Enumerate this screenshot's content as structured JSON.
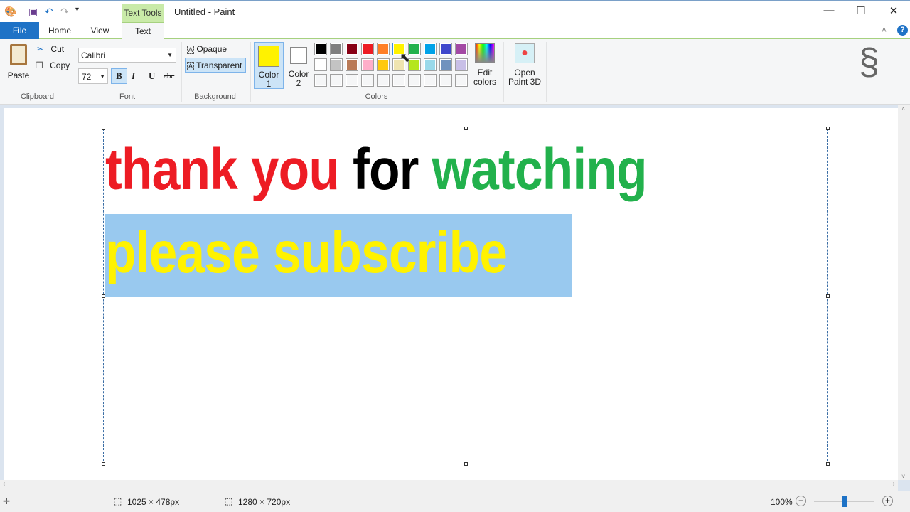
{
  "window": {
    "title": "Untitled - Paint",
    "context_tab": "Text Tools",
    "minimize": "—",
    "maximize": "☐",
    "close": "✕"
  },
  "tabs": [
    {
      "label": "File"
    },
    {
      "label": "Home"
    },
    {
      "label": "View"
    },
    {
      "label": "Text"
    }
  ],
  "clipboard": {
    "paste": "Paste",
    "cut": "Cut",
    "copy": "Copy",
    "group": "Clipboard"
  },
  "font": {
    "family": "Calibri",
    "size": "72",
    "bold": "B",
    "italic": "I",
    "underline": "U",
    "strike": "abc",
    "group": "Font"
  },
  "background": {
    "opaque": "Opaque",
    "transparent": "Transparent",
    "group": "Background"
  },
  "colors": {
    "color1_label": "Color",
    "color1_num": "1",
    "color2_label": "Color",
    "color2_num": "2",
    "color1": "#FFF200",
    "color2": "#FFFFFF",
    "edit": "Edit colors",
    "group": "Colors",
    "palette_row1": [
      "#000000",
      "#7F7F7F",
      "#880015",
      "#ED1C24",
      "#FF7F27",
      "#FFF200",
      "#22B14C",
      "#00A2E8",
      "#3F48CC",
      "#A349A4"
    ],
    "palette_row2": [
      "#FFFFFF",
      "#C3C3C3",
      "#B97A57",
      "#FFAEC9",
      "#FFC90E",
      "#EFE4B0",
      "#B5E61D",
      "#99D9EA",
      "#7092BE",
      "#C8BFE7"
    ]
  },
  "paint3d": {
    "label": "Open Paint 3D"
  },
  "canvas": {
    "words": [
      {
        "text": "thank you",
        "color": "#ED1C24"
      },
      {
        "text": "for",
        "color": "#000000"
      },
      {
        "text": "watching",
        "color": "#22B14C"
      }
    ],
    "line2": "please subscribe",
    "line2_color": "#FFF200",
    "highlight": "#99C9EF"
  },
  "status": {
    "selection": "1025 × 478px",
    "size": "1280 × 720px",
    "zoom": "100%",
    "zoom_level_percent": 100
  }
}
